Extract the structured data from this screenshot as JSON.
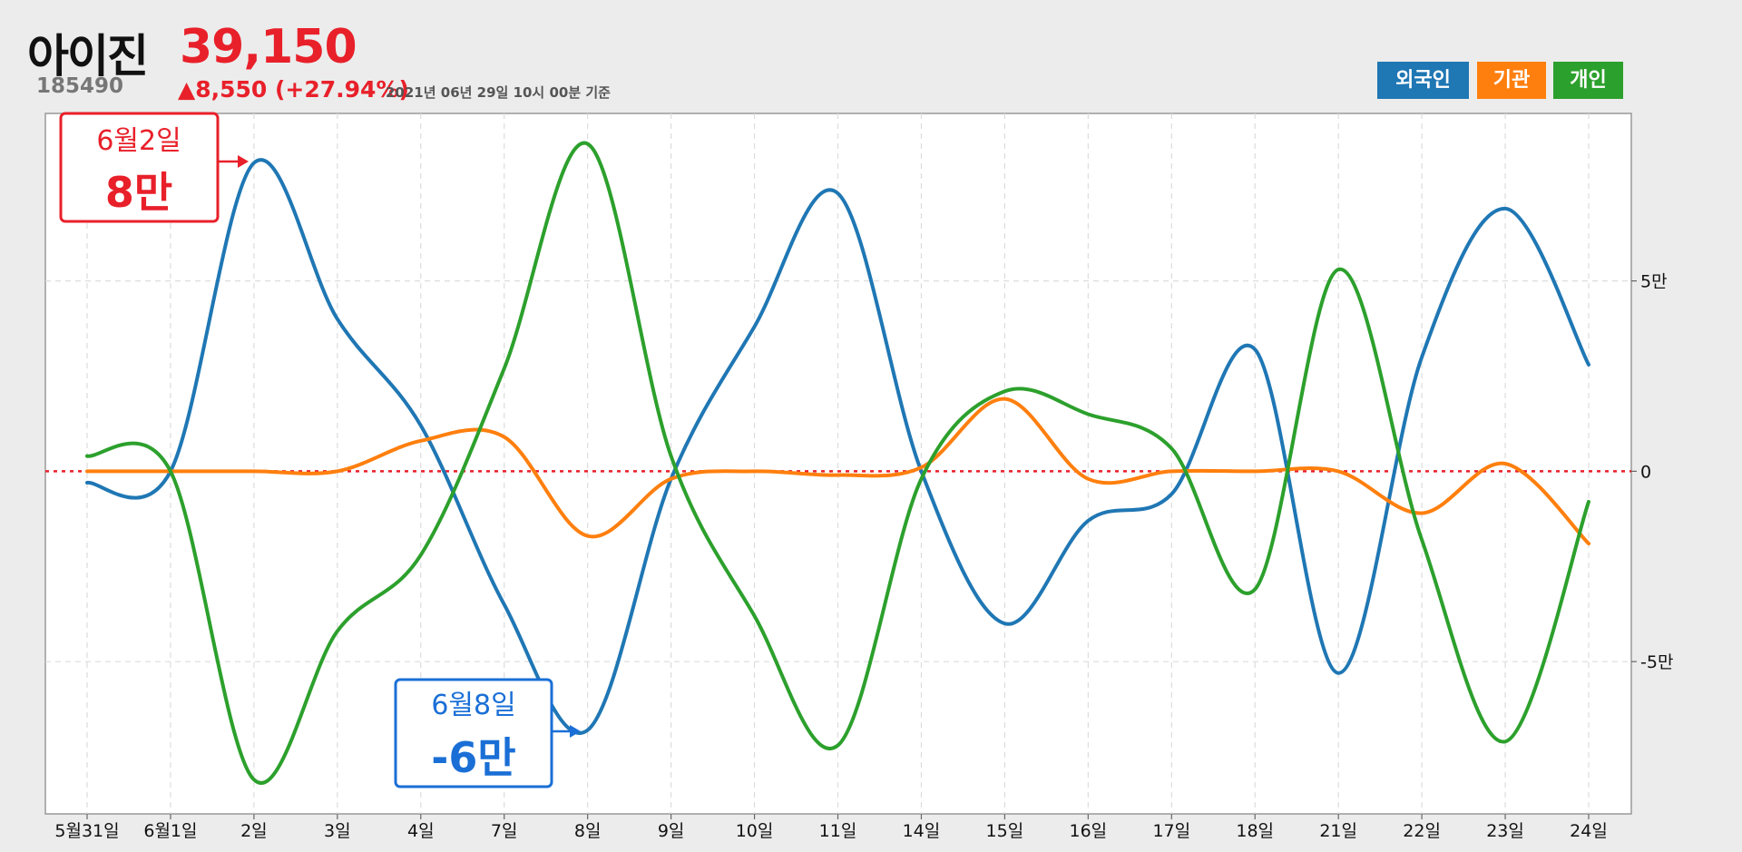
{
  "header": {
    "name": "아이진",
    "code": "185490",
    "price": "39,150",
    "change": "▲8,550 (+27.94%)",
    "asof": "2021년 06년 29일 10시 00분 기준"
  },
  "callouts": [
    {
      "date": "6월2일",
      "value": "8만",
      "color": "#e8202a"
    },
    {
      "date": "6월8일",
      "value": "-6만",
      "color": "#1a6fd6"
    }
  ],
  "chart_data": {
    "type": "line",
    "categories": [
      "5월31일",
      "6월1일",
      "2일",
      "3일",
      "4일",
      "7일",
      "8일",
      "9일",
      "10일",
      "11일",
      "14일",
      "15일",
      "16일",
      "17일",
      "18일",
      "21일",
      "22일",
      "23일",
      "24일"
    ],
    "y_tick_labels": [
      "5만",
      "0",
      "-5만"
    ],
    "y_ticks": [
      50000,
      0,
      -50000
    ],
    "ylim": [
      -90000,
      94000
    ],
    "zero_line": true,
    "grid": true,
    "legend_position": "top-right",
    "series": [
      {
        "name": "외국인",
        "color": "#1f77b4",
        "values": [
          -3000,
          0,
          81000,
          40000,
          12000,
          -35000,
          -68000,
          -2000,
          38000,
          73000,
          0,
          -40000,
          -13000,
          -6000,
          32000,
          -53000,
          30000,
          69000,
          28000
        ]
      },
      {
        "name": "기관",
        "color": "#ff7f0e",
        "values": [
          0,
          0,
          0,
          0,
          8000,
          9000,
          -17000,
          -2000,
          0,
          -1000,
          1000,
          19000,
          -2000,
          0,
          0,
          0,
          -11000,
          2000,
          -19000
        ]
      },
      {
        "name": "개인",
        "color": "#2ca02c",
        "values": [
          4000,
          0,
          -81000,
          -42000,
          -22000,
          27000,
          86000,
          4000,
          -38000,
          -72000,
          -2000,
          21000,
          15000,
          6000,
          -31000,
          53000,
          -18000,
          -71000,
          -8000
        ]
      }
    ]
  }
}
